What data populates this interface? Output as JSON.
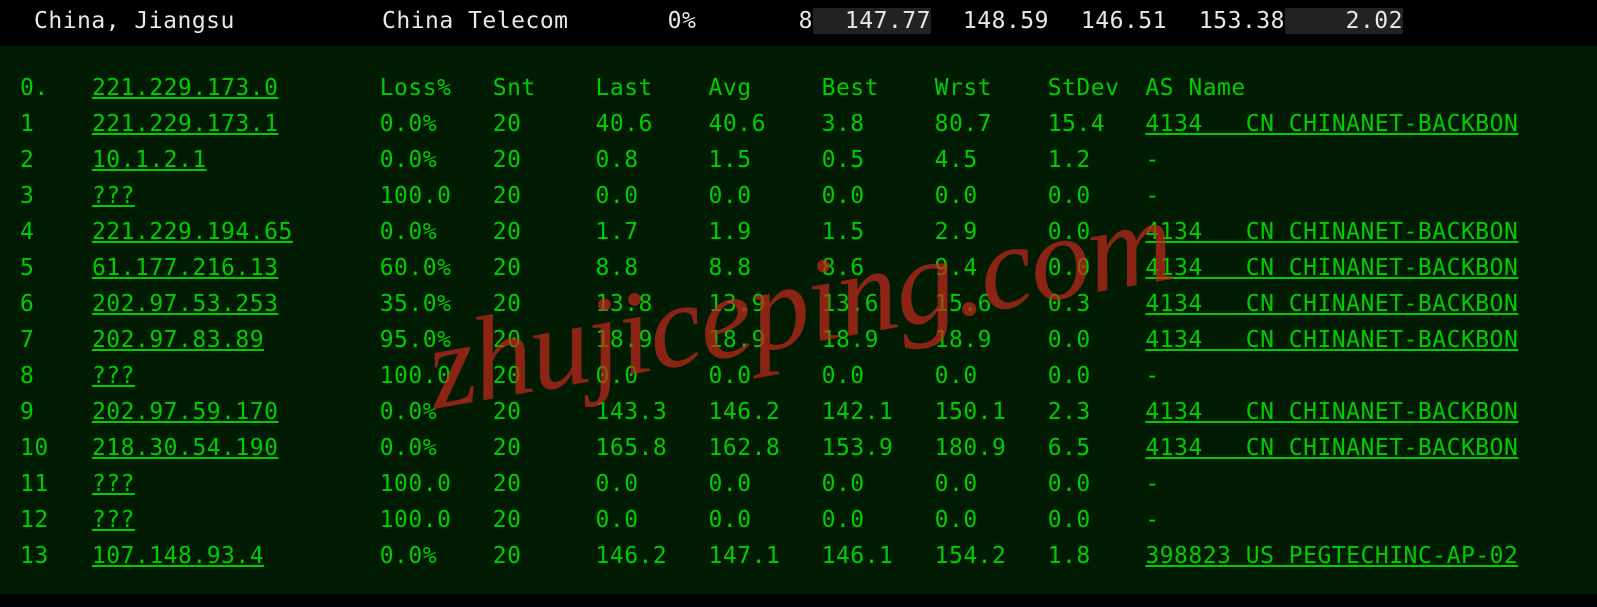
{
  "watermark": "zhujiceping.com",
  "top": {
    "location": "China, Jiangsu",
    "isp": "China Telecom",
    "loss": "0%",
    "snt": "8",
    "vals": [
      "147.77",
      "148.59",
      "146.51",
      "153.38",
      "2.02"
    ]
  },
  "headers": {
    "idx": "0.",
    "host": "221.229.173.0",
    "loss": "Loss%",
    "snt": "Snt",
    "last": "Last",
    "avg": "Avg",
    "best": "Best",
    "wrst": "Wrst",
    "stdev": "StDev",
    "asn": "AS Name"
  },
  "hops": [
    {
      "idx": "1",
      "host": "221.229.173.1",
      "loss": "0.0%",
      "snt": "20",
      "last": "40.6",
      "avg": "40.6",
      "best": "3.8",
      "wrst": "80.7",
      "stdev": "15.4",
      "asnum": "4134",
      "cc": "CN",
      "asname": "CHINANET-BACKBON"
    },
    {
      "idx": "2",
      "host": "10.1.2.1",
      "loss": "0.0%",
      "snt": "20",
      "last": "0.8",
      "avg": "1.5",
      "best": "0.5",
      "wrst": "4.5",
      "stdev": "1.2",
      "asnum": "-",
      "cc": "",
      "asname": ""
    },
    {
      "idx": "3",
      "host": "???",
      "loss": "100.0",
      "snt": "20",
      "last": "0.0",
      "avg": "0.0",
      "best": "0.0",
      "wrst": "0.0",
      "stdev": "0.0",
      "asnum": "-",
      "cc": "",
      "asname": ""
    },
    {
      "idx": "4",
      "host": "221.229.194.65",
      "loss": "0.0%",
      "snt": "20",
      "last": "1.7",
      "avg": "1.9",
      "best": "1.5",
      "wrst": "2.9",
      "stdev": "0.0",
      "asnum": "4134",
      "cc": "CN",
      "asname": "CHINANET-BACKBON"
    },
    {
      "idx": "5",
      "host": "61.177.216.13",
      "loss": "60.0%",
      "snt": "20",
      "last": "8.8",
      "avg": "8.8",
      "best": "8.6",
      "wrst": "9.4",
      "stdev": "0.0",
      "asnum": "4134",
      "cc": "CN",
      "asname": "CHINANET-BACKBON"
    },
    {
      "idx": "6",
      "host": "202.97.53.253",
      "loss": "35.0%",
      "snt": "20",
      "last": "13.8",
      "avg": "13.9",
      "best": "13.6",
      "wrst": "15.6",
      "stdev": "0.3",
      "asnum": "4134",
      "cc": "CN",
      "asname": "CHINANET-BACKBON"
    },
    {
      "idx": "7",
      "host": "202.97.83.89",
      "loss": "95.0%",
      "snt": "20",
      "last": "18.9",
      "avg": "18.9",
      "best": "18.9",
      "wrst": "18.9",
      "stdev": "0.0",
      "asnum": "4134",
      "cc": "CN",
      "asname": "CHINANET-BACKBON"
    },
    {
      "idx": "8",
      "host": "???",
      "loss": "100.0",
      "snt": "20",
      "last": "0.0",
      "avg": "0.0",
      "best": "0.0",
      "wrst": "0.0",
      "stdev": "0.0",
      "asnum": "-",
      "cc": "",
      "asname": ""
    },
    {
      "idx": "9",
      "host": "202.97.59.170",
      "loss": "0.0%",
      "snt": "20",
      "last": "143.3",
      "avg": "146.2",
      "best": "142.1",
      "wrst": "150.1",
      "stdev": "2.3",
      "asnum": "4134",
      "cc": "CN",
      "asname": "CHINANET-BACKBON"
    },
    {
      "idx": "10",
      "host": "218.30.54.190",
      "loss": "0.0%",
      "snt": "20",
      "last": "165.8",
      "avg": "162.8",
      "best": "153.9",
      "wrst": "180.9",
      "stdev": "6.5",
      "asnum": "4134",
      "cc": "CN",
      "asname": "CHINANET-BACKBON"
    },
    {
      "idx": "11",
      "host": "???",
      "loss": "100.0",
      "snt": "20",
      "last": "0.0",
      "avg": "0.0",
      "best": "0.0",
      "wrst": "0.0",
      "stdev": "0.0",
      "asnum": "-",
      "cc": "",
      "asname": ""
    },
    {
      "idx": "12",
      "host": "???",
      "loss": "100.0",
      "snt": "20",
      "last": "0.0",
      "avg": "0.0",
      "best": "0.0",
      "wrst": "0.0",
      "stdev": "0.0",
      "asnum": "-",
      "cc": "",
      "asname": ""
    },
    {
      "idx": "13",
      "host": "107.148.93.4",
      "loss": "0.0%",
      "snt": "20",
      "last": "146.2",
      "avg": "147.1",
      "best": "146.1",
      "wrst": "154.2",
      "stdev": "1.8",
      "asnum": "398823",
      "cc": "US",
      "asname": "PEGTECHINC-AP-02"
    }
  ]
}
